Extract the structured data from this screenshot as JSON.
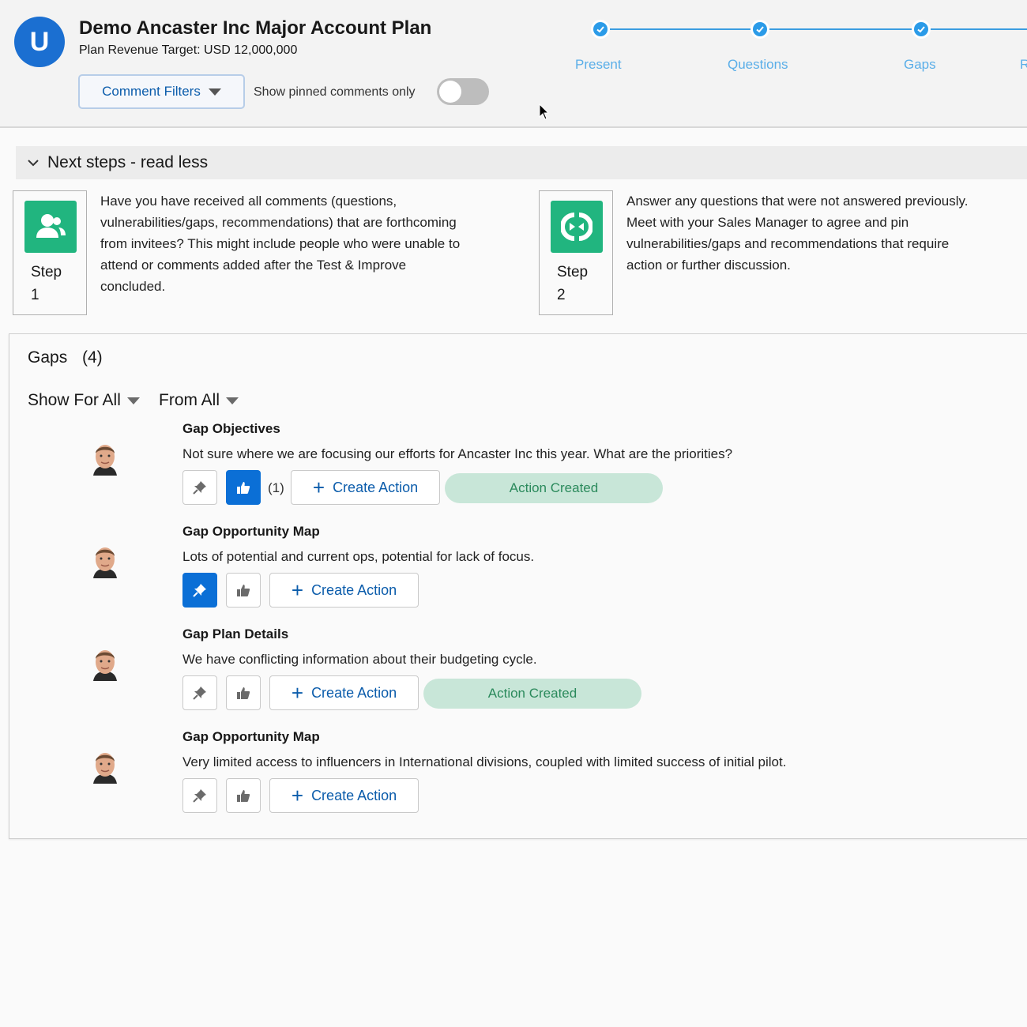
{
  "header": {
    "logo_letter": "U",
    "title": "Demo Ancaster Inc Major Account Plan",
    "subtitle": "Plan Revenue Target: USD 12,000,000",
    "filter_button": "Comment Filters",
    "toggle_label": "Show pinned comments only",
    "toggle_on": false
  },
  "path": {
    "steps": [
      {
        "label": "Present",
        "complete": true
      },
      {
        "label": "Questions",
        "complete": true
      },
      {
        "label": "Gaps",
        "complete": true
      },
      {
        "label": "R",
        "complete": true
      }
    ]
  },
  "next_steps": {
    "title": "Next steps - read less",
    "steps": [
      {
        "word": "Step",
        "number": "1",
        "icon": "users-icon",
        "lines": [
          "Have you have received all comments (questions,",
          "vulnerabilities/gaps, recommendations) that are forthcoming",
          "from invitees? This might include people who were unable to",
          "attend or comments added after the Test & Improve",
          "concluded."
        ]
      },
      {
        "word": "Step",
        "number": "2",
        "icon": "refresh-icon",
        "lines": [
          "Answer any questions that were not answered previously.",
          "Meet with your Sales Manager to agree and pin",
          "vulnerabilities/gaps and recommendations that require",
          "action or further discussion."
        ]
      }
    ]
  },
  "gaps": {
    "title": "Gaps",
    "count": "(4)",
    "filter_show": "Show For All",
    "filter_from": "From All",
    "create_label": "Create Action",
    "action_created_label": "Action Created",
    "comments": [
      {
        "title": "Gap Objectives",
        "body": "Not sure where we are focusing our efforts for Ancaster Inc this year. What are the priorities?",
        "pinned": false,
        "liked": true,
        "like_count": "(1)",
        "action_created": true
      },
      {
        "title": "Gap Opportunity Map",
        "body": "Lots of potential and current ops, potential for lack of focus.",
        "pinned": true,
        "liked": false,
        "like_count": "",
        "action_created": false
      },
      {
        "title": "Gap Plan Details",
        "body": "We have conflicting information about their budgeting cycle.",
        "pinned": false,
        "liked": false,
        "like_count": "",
        "action_created": true
      },
      {
        "title": "Gap Opportunity Map",
        "body": "Very limited access to influencers in International divisions, coupled with limited success of initial pilot.",
        "pinned": false,
        "liked": false,
        "like_count": "",
        "action_created": false
      }
    ]
  },
  "colors": {
    "brand_blue": "#1b6fd1",
    "link_blue": "#0b5cab",
    "path_blue": "#2b9be8",
    "step_green": "#21b57f",
    "pill_bg": "#c8e6d8",
    "pill_text": "#2b8a5c"
  }
}
